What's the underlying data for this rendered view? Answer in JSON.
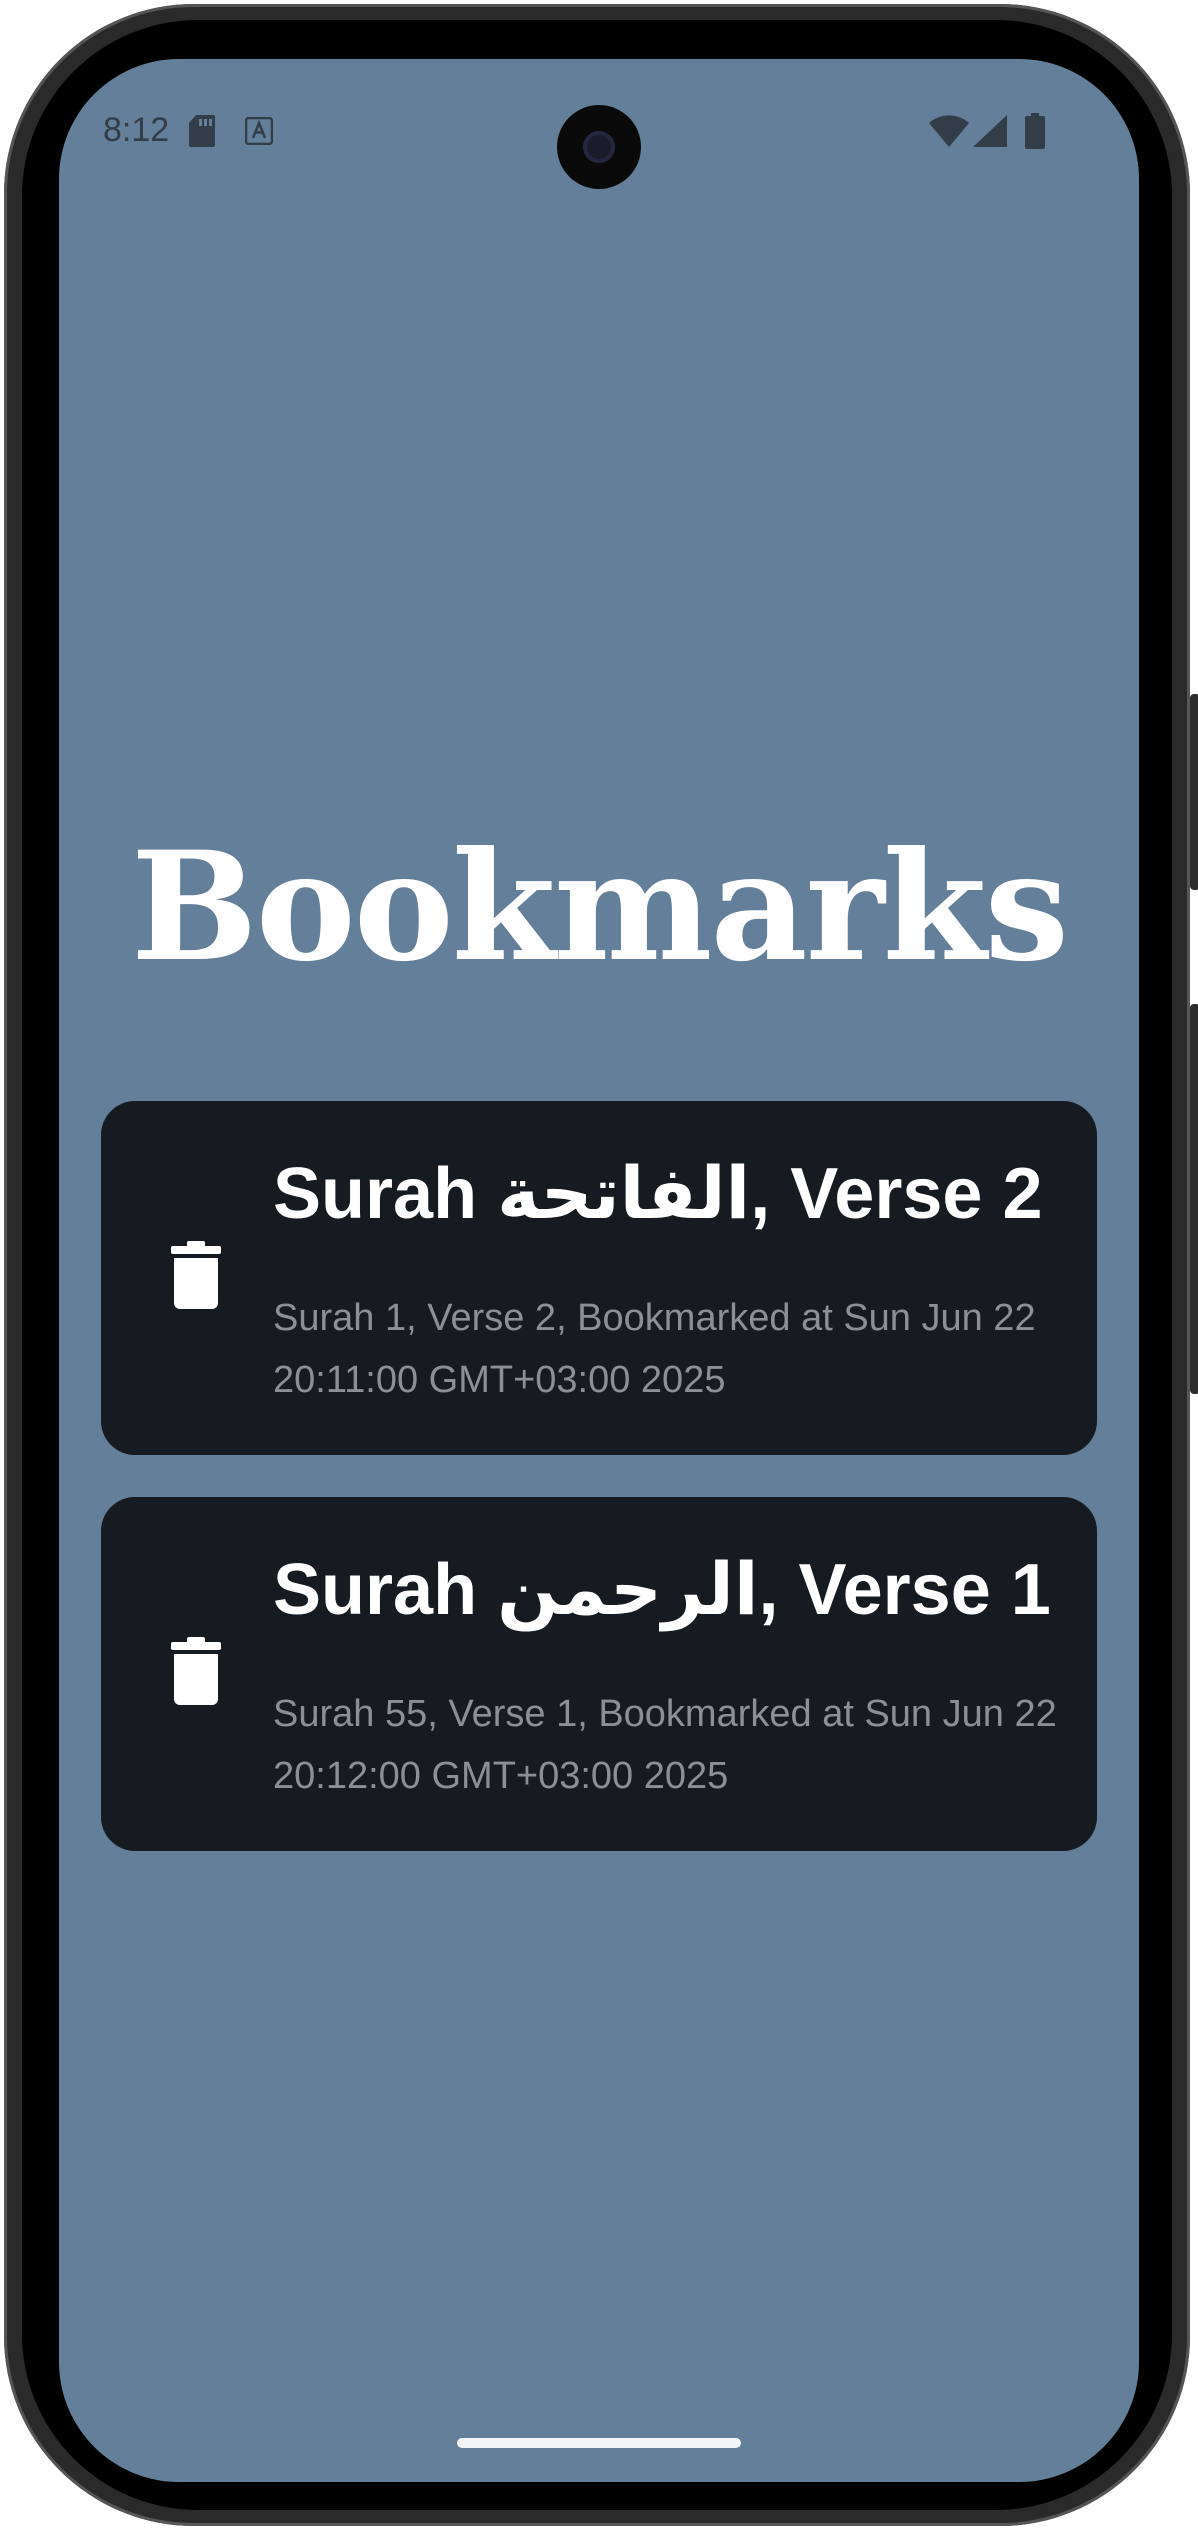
{
  "status_bar": {
    "time": "8:12",
    "icons": [
      "sd-card-icon",
      "text-a-icon",
      "wifi-icon",
      "cell-signal-icon",
      "battery-icon"
    ]
  },
  "page": {
    "title": "Bookmarks",
    "background_color": "#637f99",
    "card_color": "#161b21"
  },
  "bookmarks": [
    {
      "title": "Surah الفاتحة, Verse 2",
      "subtitle": "Surah 1, Verse 2, Bookmarked at Sun Jun 22 20:11:00 GMT+03:00 2025",
      "delete_icon": "trash-icon"
    },
    {
      "title": "Surah الرحمن, Verse 1",
      "subtitle": "Surah 55, Verse 1, Bookmarked at Sun Jun 22 20:12:00 GMT+03:00 2025",
      "delete_icon": "trash-icon"
    }
  ]
}
